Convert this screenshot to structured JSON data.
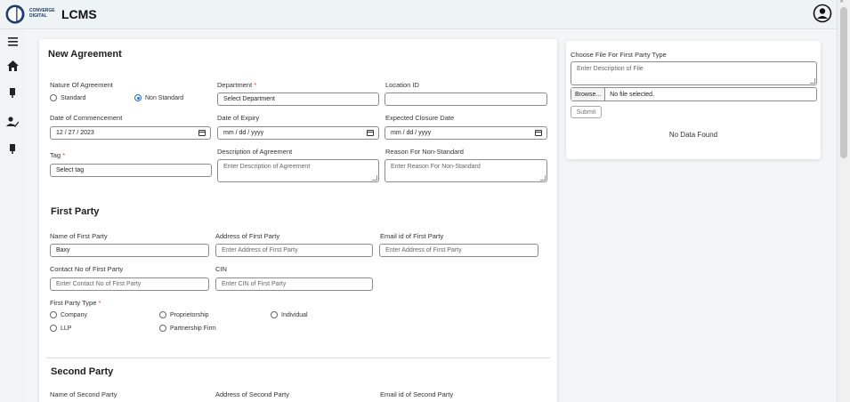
{
  "header": {
    "logo_line1": "CONVERGE",
    "logo_line2": "DIGITAL",
    "app_title": "LCMS",
    "user_icon": "user-circle-icon"
  },
  "sidebar": {
    "items": [
      {
        "icon": "menu-icon"
      },
      {
        "icon": "home-icon"
      },
      {
        "icon": "document-icon"
      },
      {
        "icon": "user-check-icon"
      },
      {
        "icon": "document-icon"
      }
    ]
  },
  "agreement": {
    "title": "New Agreement",
    "nature_label": "Nature Of Agreement",
    "nature_options": [
      "Standard",
      "Non Standard"
    ],
    "nature_selected": "Non Standard",
    "department_label": "Department",
    "department_value": "Select Department",
    "location_label": "Location ID",
    "location_value": "",
    "commencement_label": "Date of Commencement",
    "commencement_value": "12 / 27 / 2023",
    "expiry_label": "Date of Expiry",
    "expiry_value": "mm / dd / yyyy",
    "closure_label": "Expected Closure Date",
    "closure_value": "mm / dd / yyyy",
    "tag_label": "Tag",
    "tag_value": "Select tag",
    "description_label": "Description of Agreement",
    "description_placeholder": "Enter Description of Agreement",
    "reason_label": "Reason For Non-Standard",
    "reason_placeholder": "Enter Reason For Non-Standard",
    "required_mark": "*"
  },
  "first_party": {
    "title": "First Party",
    "name_label": "Name of First Party",
    "name_value": "Baxy",
    "address_label": "Address of First Party",
    "address_placeholder": "Enter Address of First Party",
    "email_label": "Email id of First Party",
    "email_placeholder": "Enter Address of First Party",
    "contact_label": "Contact No of First Party",
    "contact_placeholder": "Enter Contact No of First Party",
    "cin_label": "CIN",
    "cin_placeholder": "Enter CIN of First Party",
    "type_label": "First Party Type",
    "type_options": [
      "Company",
      "Proprietorship",
      "Individual",
      "LLP",
      "Partnership Firm"
    ]
  },
  "second_party": {
    "title": "Second Party",
    "name_label": "Name of Second Party",
    "address_label": "Address of Second Party",
    "email_label": "Email id of Second Party"
  },
  "file_panel": {
    "title": "Choose File For First Party Type",
    "description_placeholder": "Enter Description of File",
    "browse_label": "Browse...",
    "file_status": "No file selected.",
    "submit_label": "Submit",
    "empty_text": "No Data Found"
  },
  "colors": {
    "accent": "#1e6fd9",
    "required": "#e53935",
    "topbar": "#eef3f4"
  }
}
